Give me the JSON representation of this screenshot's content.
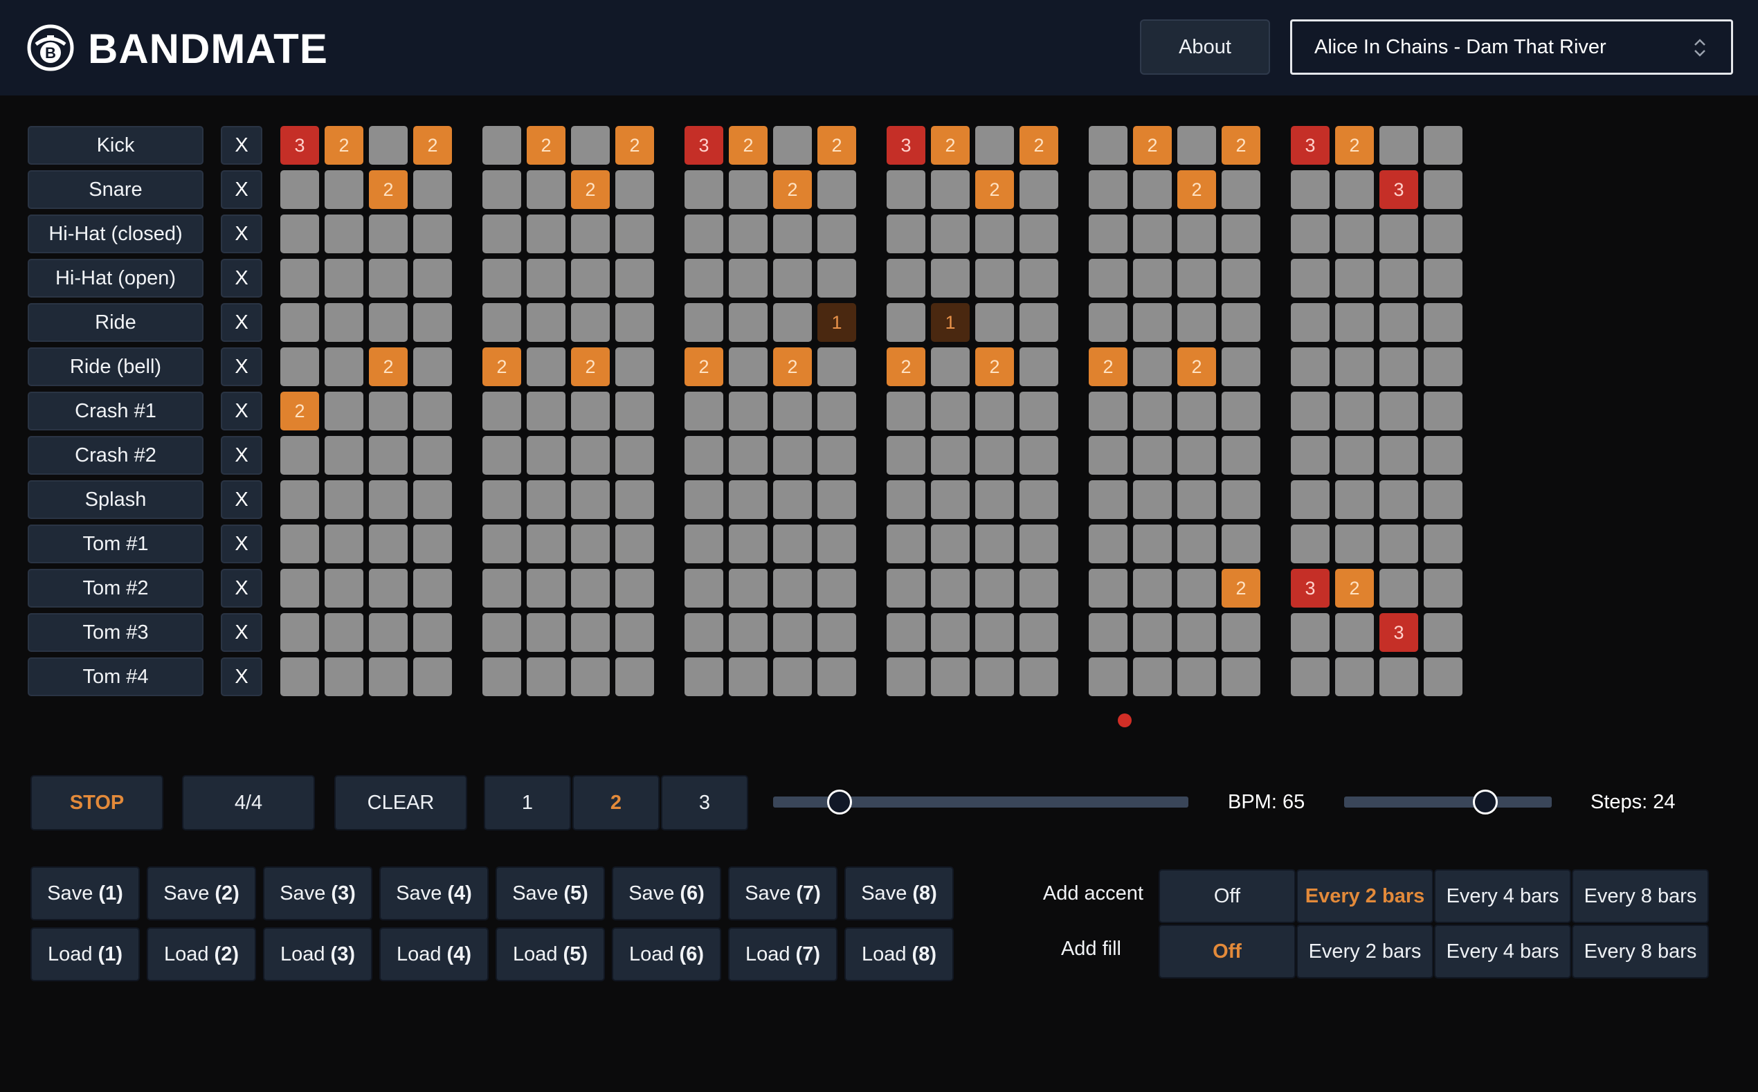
{
  "app": {
    "brand": "BANDMATE",
    "about_label": "About",
    "song_selected": "Alice In Chains - Dam That River"
  },
  "colors": {
    "accent": "#e38a3a",
    "hit_level_1": "#4a2810",
    "hit_level_2": "#e0822e",
    "hit_level_3": "#c52f27",
    "empty_cell": "#8e8e8e",
    "panel": "#1f2937",
    "header": "#111827"
  },
  "icons": {
    "logo": "drum-logo-icon",
    "select": "chevron-updown-icon"
  },
  "mute_label": "X",
  "rows": [
    {
      "name": "Kick",
      "steps": [
        3,
        2,
        0,
        2,
        0,
        2,
        0,
        2,
        3,
        2,
        0,
        2,
        3,
        2,
        0,
        2,
        0,
        2,
        0,
        2,
        3,
        2,
        0,
        0
      ]
    },
    {
      "name": "Snare",
      "steps": [
        0,
        0,
        2,
        0,
        0,
        0,
        2,
        0,
        0,
        0,
        2,
        0,
        0,
        0,
        2,
        0,
        0,
        0,
        2,
        0,
        0,
        0,
        3,
        0
      ]
    },
    {
      "name": "Hi-Hat (closed)",
      "steps": [
        0,
        0,
        0,
        0,
        0,
        0,
        0,
        0,
        0,
        0,
        0,
        0,
        0,
        0,
        0,
        0,
        0,
        0,
        0,
        0,
        0,
        0,
        0,
        0
      ]
    },
    {
      "name": "Hi-Hat (open)",
      "steps": [
        0,
        0,
        0,
        0,
        0,
        0,
        0,
        0,
        0,
        0,
        0,
        0,
        0,
        0,
        0,
        0,
        0,
        0,
        0,
        0,
        0,
        0,
        0,
        0
      ]
    },
    {
      "name": "Ride",
      "steps": [
        0,
        0,
        0,
        0,
        0,
        0,
        0,
        0,
        0,
        0,
        0,
        1,
        0,
        1,
        0,
        0,
        0,
        0,
        0,
        0,
        0,
        0,
        0,
        0
      ]
    },
    {
      "name": "Ride (bell)",
      "steps": [
        0,
        0,
        2,
        0,
        2,
        0,
        2,
        0,
        2,
        0,
        2,
        0,
        2,
        0,
        2,
        0,
        2,
        0,
        2,
        0,
        0,
        0,
        0,
        0
      ]
    },
    {
      "name": "Crash #1",
      "steps": [
        2,
        0,
        0,
        0,
        0,
        0,
        0,
        0,
        0,
        0,
        0,
        0,
        0,
        0,
        0,
        0,
        0,
        0,
        0,
        0,
        0,
        0,
        0,
        0
      ]
    },
    {
      "name": "Crash #2",
      "steps": [
        0,
        0,
        0,
        0,
        0,
        0,
        0,
        0,
        0,
        0,
        0,
        0,
        0,
        0,
        0,
        0,
        0,
        0,
        0,
        0,
        0,
        0,
        0,
        0
      ]
    },
    {
      "name": "Splash",
      "steps": [
        0,
        0,
        0,
        0,
        0,
        0,
        0,
        0,
        0,
        0,
        0,
        0,
        0,
        0,
        0,
        0,
        0,
        0,
        0,
        0,
        0,
        0,
        0,
        0
      ]
    },
    {
      "name": "Tom #1",
      "steps": [
        0,
        0,
        0,
        0,
        0,
        0,
        0,
        0,
        0,
        0,
        0,
        0,
        0,
        0,
        0,
        0,
        0,
        0,
        0,
        0,
        0,
        0,
        0,
        0
      ]
    },
    {
      "name": "Tom #2",
      "steps": [
        0,
        0,
        0,
        0,
        0,
        0,
        0,
        0,
        0,
        0,
        0,
        0,
        0,
        0,
        0,
        0,
        0,
        0,
        0,
        2,
        3,
        2,
        0,
        0
      ]
    },
    {
      "name": "Tom #3",
      "steps": [
        0,
        0,
        0,
        0,
        0,
        0,
        0,
        0,
        0,
        0,
        0,
        0,
        0,
        0,
        0,
        0,
        0,
        0,
        0,
        0,
        0,
        0,
        3,
        0
      ]
    },
    {
      "name": "Tom #4",
      "steps": [
        0,
        0,
        0,
        0,
        0,
        0,
        0,
        0,
        0,
        0,
        0,
        0,
        0,
        0,
        0,
        0,
        0,
        0,
        0,
        0,
        0,
        0,
        0,
        0
      ]
    }
  ],
  "playhead_step": 17,
  "transport": {
    "stop_label": "STOP",
    "time_signature": "4/4",
    "clear_label": "CLEAR",
    "subdivisions": [
      "1",
      "2",
      "3"
    ],
    "subdivision_selected": 1
  },
  "bpm": {
    "label": "BPM: 65",
    "value": 65,
    "level": 0.16
  },
  "steps": {
    "label": "Steps: 24",
    "value": 24,
    "level": 0.68
  },
  "slots": {
    "save_label": "Save",
    "load_label": "Load",
    "numbers": [
      "(1)",
      "(2)",
      "(3)",
      "(4)",
      "(5)",
      "(6)",
      "(7)",
      "(8)"
    ]
  },
  "options": {
    "accent_label": "Add accent",
    "fill_label": "Add fill",
    "choices": [
      "Off",
      "Every 2 bars",
      "Every 4 bars",
      "Every 8 bars"
    ],
    "accent_selected": 1,
    "fill_selected": 0
  }
}
